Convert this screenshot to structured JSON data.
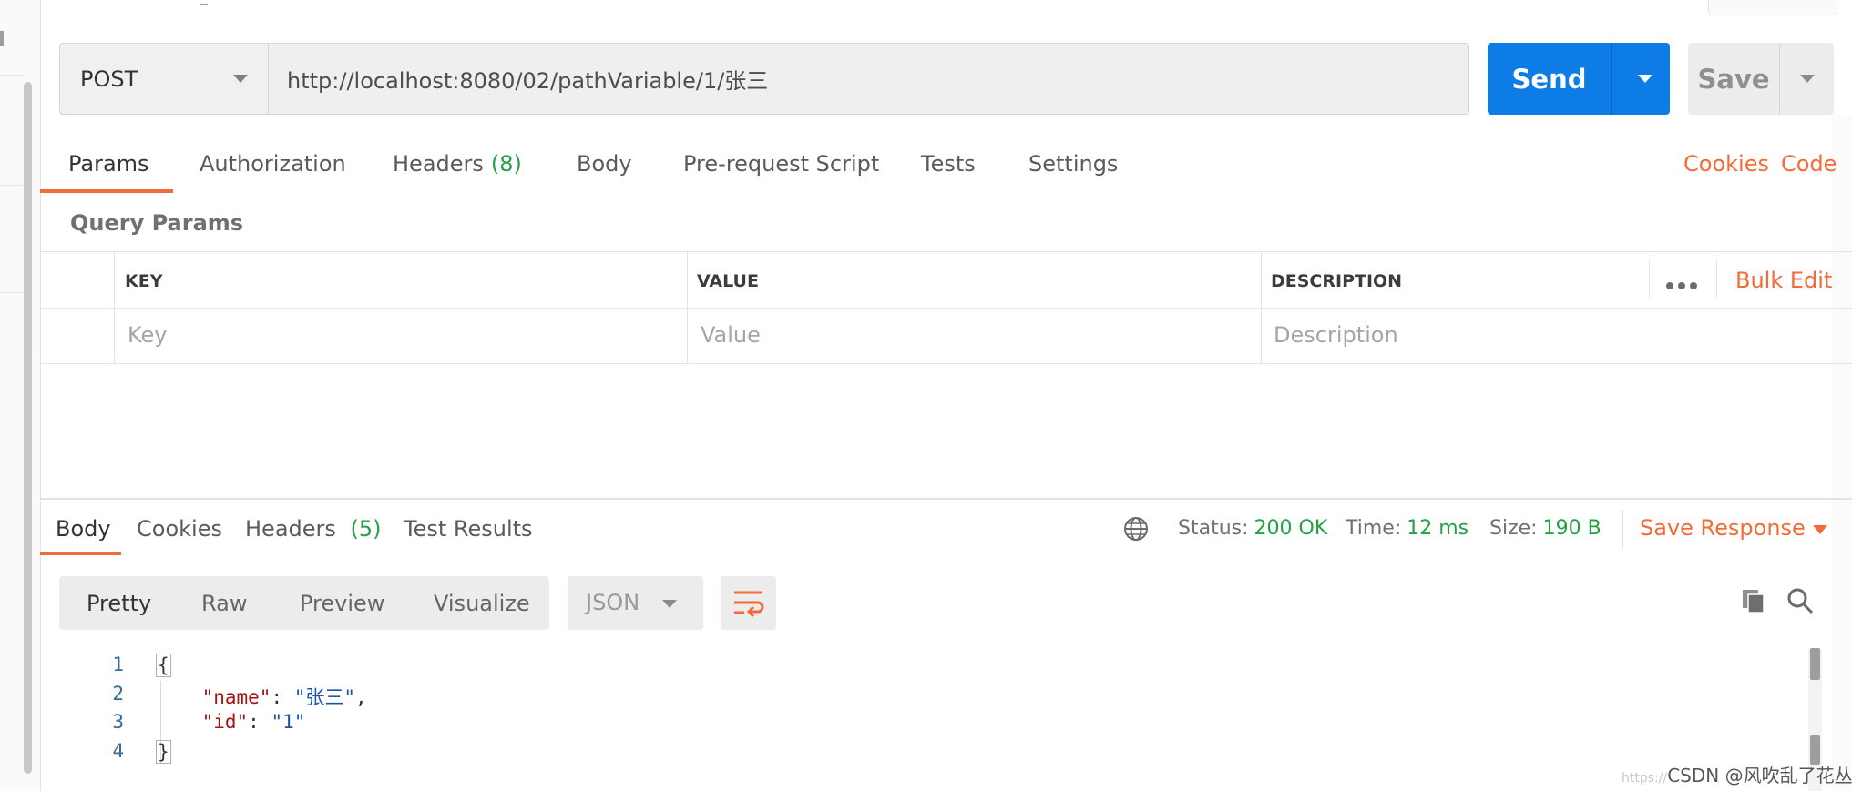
{
  "request": {
    "method": "POST",
    "url": "http://localhost:8080/02/pathVariable/1/张三",
    "send_label": "Send",
    "save_label": "Save"
  },
  "request_tabs": {
    "params": "Params",
    "authorization": "Authorization",
    "headers": "Headers",
    "headers_count": "(8)",
    "body": "Body",
    "pre_request_script": "Pre-request Script",
    "tests": "Tests",
    "settings": "Settings",
    "cookies": "Cookies",
    "code": "Code"
  },
  "query_params": {
    "title": "Query Params",
    "columns": {
      "key": "KEY",
      "value": "VALUE",
      "description": "DESCRIPTION"
    },
    "placeholders": {
      "key": "Key",
      "value": "Value",
      "description": "Description"
    },
    "bulk_edit": "Bulk Edit"
  },
  "response_tabs": {
    "body": "Body",
    "cookies": "Cookies",
    "headers": "Headers",
    "headers_count": "(5)",
    "test_results": "Test Results"
  },
  "response_status": {
    "status_label": "Status:",
    "status_value": "200 OK",
    "time_label": "Time:",
    "time_value": "12 ms",
    "size_label": "Size:",
    "size_value": "190 B",
    "save_response": "Save Response"
  },
  "view_modes": {
    "pretty": "Pretty",
    "raw": "Raw",
    "preview": "Preview",
    "visualize": "Visualize",
    "format": "JSON"
  },
  "code": {
    "line_numbers": [
      "1",
      "2",
      "3",
      "4"
    ],
    "open_brace": "{",
    "close_brace": "}",
    "name_key": "\"name\"",
    "name_value": "\"张三\"",
    "id_key": "\"id\"",
    "id_value": "\"1\""
  },
  "watermark": {
    "faint": "https://",
    "text": "CSDN @风吹乱了花丛"
  },
  "colors": {
    "accent": "#f26b3a",
    "send": "#0d7ce6",
    "success": "#26a047"
  }
}
